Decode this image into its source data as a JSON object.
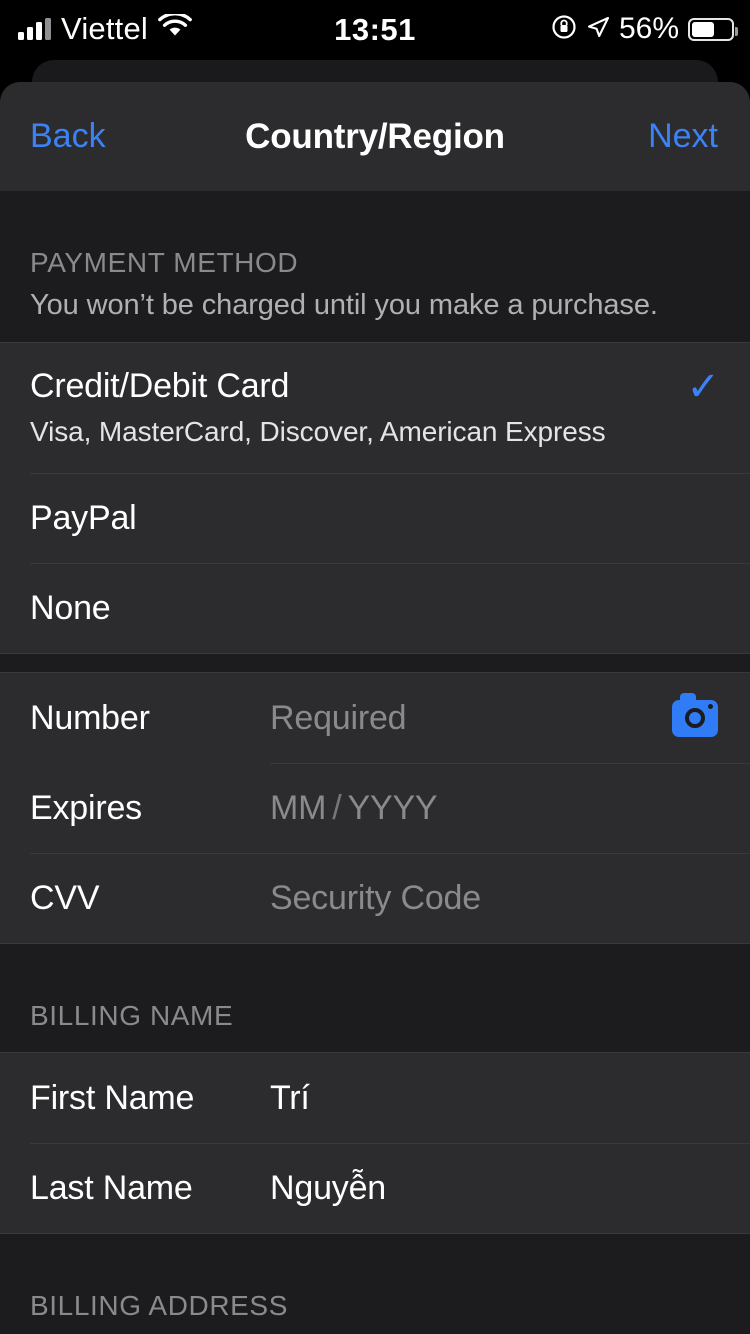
{
  "status_bar": {
    "carrier": "Viettel",
    "wifi_icon": "wifi-icon",
    "time": "13:51",
    "rotation_lock_icon": "rotation-lock-icon",
    "location_icon": "location-arrow-icon",
    "battery_percent": "56%"
  },
  "nav": {
    "back_label": "Back",
    "title": "Country/Region",
    "next_label": "Next",
    "accent_color": "#3b82f6"
  },
  "payment_section": {
    "header": "PAYMENT METHOD",
    "subtitle": "You won’t be charged until you make a purchase.",
    "options": [
      {
        "label": "Credit/Debit Card",
        "detail": "Visa, MasterCard, Discover, American Express",
        "selected": true,
        "check_glyph": "✓"
      },
      {
        "label": "PayPal",
        "detail": "",
        "selected": false
      },
      {
        "label": "None",
        "detail": "",
        "selected": false
      }
    ]
  },
  "card_section": {
    "fields": [
      {
        "label": "Number",
        "value": "",
        "placeholder": "Required",
        "accessory_icon": "camera-icon"
      },
      {
        "label": "Expires",
        "value": "",
        "placeholder_month": "MM",
        "placeholder_separator": "/",
        "placeholder_year": "YYYY"
      },
      {
        "label": "CVV",
        "value": "",
        "placeholder": "Security Code"
      }
    ]
  },
  "billing_name_section": {
    "header": "BILLING NAME",
    "fields": [
      {
        "label": "First Name",
        "value": "Trí"
      },
      {
        "label": "Last Name",
        "value": "Nguyễn"
      }
    ]
  },
  "billing_address_section": {
    "header": "BILLING ADDRESS"
  },
  "colors": {
    "sheet_background": "#1c1c1e",
    "row_background": "#2c2c2e",
    "separator": "#3a3a3c",
    "accent": "#3b82f6",
    "secondary_text": "#8a8a8e"
  }
}
